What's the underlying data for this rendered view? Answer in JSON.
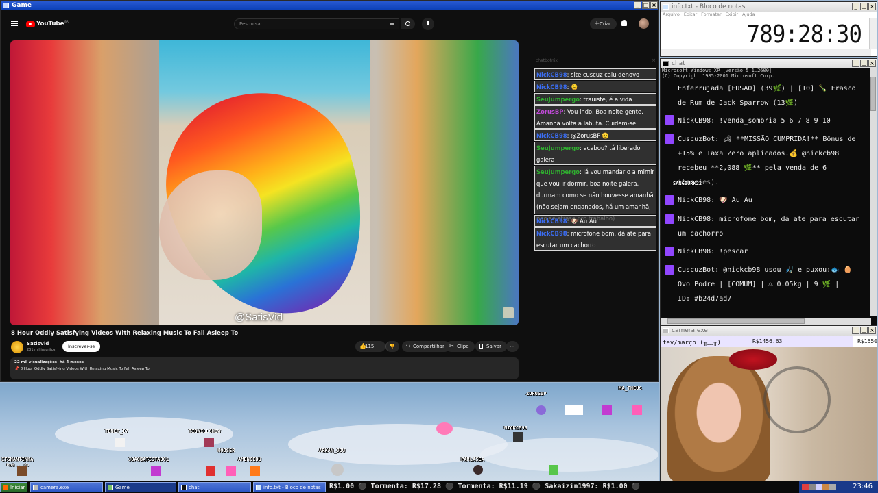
{
  "game_window": {
    "title": "Game",
    "youtube": {
      "logo_text": "YouTube",
      "region_code": "BR",
      "search_placeholder": "Pesquisar",
      "create_label": "Criar",
      "video_watermark": "@SatisVid",
      "video_title": "8 Hour Oddly Satisfying Videos With Relaxing Music To Fall Asleep To",
      "channel_name": "SatisVid",
      "subscribers": "231 mil inscritos",
      "subscribe_label": "Inscrever-se",
      "likes": "115",
      "share_label": "Compartilhar",
      "clip_label": "Clipe",
      "save_label": "Salvar",
      "views": "22 mil visualizações",
      "published": "há 4 meses",
      "description_line": "8 Hour Oddly Satisfying Videos With Relaxing Music To Fall Asleep To"
    },
    "chat_overlay": {
      "header": "chatbotnix",
      "messages": [
        {
          "user": "NickCB98",
          "text": ": site cuscuz caiu denovo",
          "color": "b"
        },
        {
          "user": "NickCB98",
          "text": ": 🫠",
          "color": "b"
        },
        {
          "user": "SeuJumpergo",
          "text": ": trauiste, é a vida",
          "color": "g"
        },
        {
          "user": "ZorusBP",
          "text": ": Vou indo. Boa noite gente. Amanhã volta a labuta. Cuidem-se",
          "color": "p"
        },
        {
          "user": "NickCB98",
          "text": ": @ZorusBP 🫡",
          "color": "b"
        },
        {
          "user": "SeuJumpergo",
          "text": ": acabou? tá liberado galera",
          "color": "g"
        },
        {
          "user": "SeuJumpergo",
          "text": ": já vou mandar o a mimir que vou ir dormir, boa noite galera, durmam como se não houvesse amanhã (não sejam enganados, há um amanhã, não se atrase pro trabalho)",
          "color": "g"
        },
        {
          "user": "NickCB98",
          "text": ": 🐶 Au Au",
          "color": "b"
        },
        {
          "user": "NickCB98",
          "text": ": microfone bom, dá ate para escutar um cachorro",
          "color": "b"
        }
      ]
    }
  },
  "notepad": {
    "title": "info.txt - Bloco de notas",
    "menu": [
      "Arquivo",
      "Editar",
      "Formatar",
      "Exibir",
      "Ajuda"
    ],
    "timer": "789:28:30"
  },
  "chat_window": {
    "title": "chat",
    "header_lines": [
      "Microsoft Windows XP [versão 5.1.2600]",
      "(C) Copyright 1985-2001 Microsoft Corp."
    ],
    "lines": [
      "Enferrujada [FUSAO] (39🌿) | [10] 🍾 Frasco",
      "de Rum de Jack Sparrow (13🌿)",
      "NickCB98: !venda_sombria 5 6 7 8 9 10",
      "CuscuzBot: 🏕 **MISSÃO CUMPRIDA!** Bônus de",
      "+15% e Taxa Zero aplicados.💰 @nickcb98",
      "recebeu **2,088 🌿** pela venda de 6",
      "itens(es).",
      "NickCB98: 🐶 Au Au",
      "NickCB98: microfone bom, dá ate para escutar",
      "um cachorro",
      "NickCB98: !pescar",
      "CuscuzBot: @nickcb98 usou 🎣 e puxou:🐟 🥚",
      "Ovo Podre | [COMUM] | ⚖ 0.05kg | 9 🌿 |",
      "ID: #b24d7ad7"
    ],
    "overlay_name": "SANGBURK22"
  },
  "camera_window": {
    "title": "camera.exe",
    "goal_label": "fev/março (╥﹏╥)",
    "goal_current": "R$1456.63",
    "goal_target": "R$1650"
  },
  "game_players": [
    "ZORUSBP",
    "MA_THEUS",
    "NICKCB98",
    "TENET_17",
    "TIOWILLSHOW",
    "HODSER",
    "ARKAN_JOU",
    "ITSMANTINHA",
    "JOAOBATISTA001",
    "AMENGEDU",
    "PARLASEA"
  ],
  "game_extra_text": "Mod... de",
  "taskbar": {
    "start_label": "Iniciar",
    "buttons": [
      "camera.exe",
      "Game",
      "chat",
      "info.txt - Bloco de notas"
    ],
    "ticker": "R$1.00 ⚫ Tormenta: R$17.28 ⚫ Tormenta: R$11.19 ⚫ Sakaizin1997: R$1.00 ⚫",
    "clock": "23:46"
  }
}
